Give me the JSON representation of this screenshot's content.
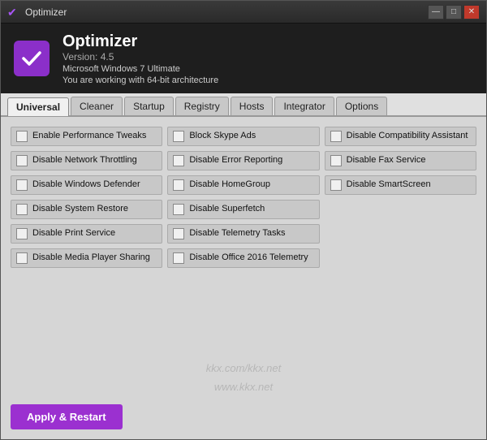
{
  "window": {
    "title": "Optimizer",
    "title_bar_icon": "✔",
    "controls": {
      "minimize": "—",
      "maximize": "□",
      "close": "✕"
    }
  },
  "header": {
    "app_name": "Optimizer",
    "version": "Version: 4.5",
    "sys_line1": "Microsoft Windows 7 Ultimate",
    "sys_line2": "You are working with 64-bit architecture"
  },
  "tabs": [
    {
      "id": "universal",
      "label": "Universal",
      "active": true
    },
    {
      "id": "cleaner",
      "label": "Cleaner",
      "active": false
    },
    {
      "id": "startup",
      "label": "Startup",
      "active": false
    },
    {
      "id": "registry",
      "label": "Registry",
      "active": false
    },
    {
      "id": "hosts",
      "label": "Hosts",
      "active": false
    },
    {
      "id": "integrator",
      "label": "Integrator",
      "active": false
    },
    {
      "id": "options",
      "label": "Options",
      "active": false
    }
  ],
  "options": {
    "col1": [
      {
        "id": "perf_tweaks",
        "label": "Enable Performance Tweaks"
      },
      {
        "id": "net_throttle",
        "label": "Disable Network Throttling"
      },
      {
        "id": "defender",
        "label": "Disable Windows Defender"
      },
      {
        "id": "sys_restore",
        "label": "Disable System Restore"
      },
      {
        "id": "print_svc",
        "label": "Disable Print Service"
      },
      {
        "id": "media_sharing",
        "label": "Disable Media Player Sharing"
      }
    ],
    "col2": [
      {
        "id": "skype_ads",
        "label": "Block Skype Ads"
      },
      {
        "id": "error_report",
        "label": "Disable Error Reporting"
      },
      {
        "id": "homegroup",
        "label": "Disable HomeGroup"
      },
      {
        "id": "superfetch",
        "label": "Disable Superfetch"
      },
      {
        "id": "telemetry",
        "label": "Disable Telemetry Tasks"
      },
      {
        "id": "office_telem",
        "label": "Disable Office 2016 Telemetry"
      }
    ],
    "col3": [
      {
        "id": "compat_asst",
        "label": "Disable Compatibility Assistant"
      },
      {
        "id": "fax_svc",
        "label": "Disable Fax Service"
      },
      {
        "id": "smartscreen",
        "label": "Disable SmartScreen"
      }
    ]
  },
  "watermark": {
    "line1": "kkx.com/kkx.net",
    "line2": "www.kkx.net"
  },
  "buttons": {
    "apply": "Apply & Restart"
  }
}
